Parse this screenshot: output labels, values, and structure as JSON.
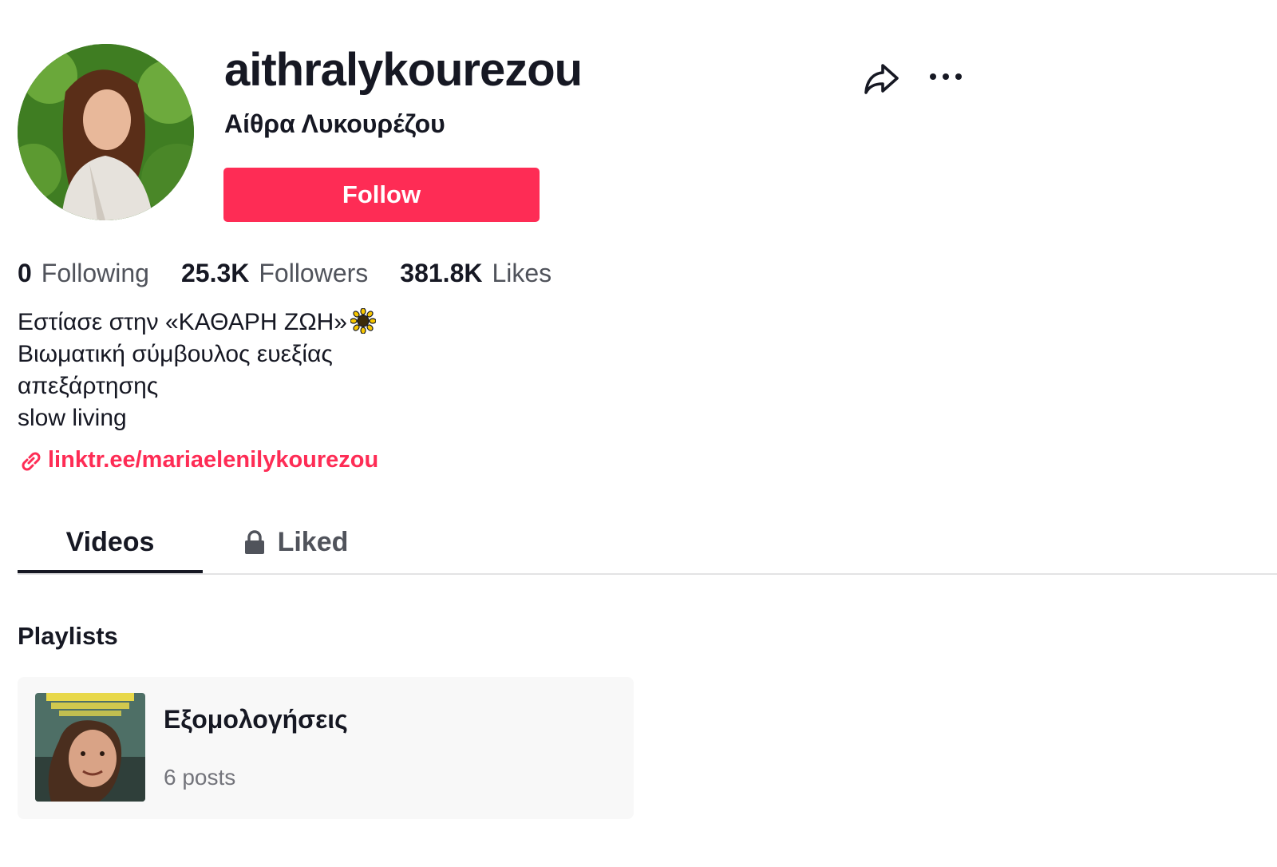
{
  "profile": {
    "username": "aithralykourezou",
    "nickname": "Αίθρα Λυκουρέζου",
    "follow_label": "Follow"
  },
  "stats": [
    {
      "count": "0",
      "label": "Following"
    },
    {
      "count": "25.3K",
      "label": "Followers"
    },
    {
      "count": "381.8K",
      "label": "Likes"
    }
  ],
  "bio": {
    "lines": [
      "Εστίασε στην «ΚΑΘΑΡΗ ΖΩΗ»",
      "Βιωματική σύμβουλος ευεξίας",
      "απεξάρτησης",
      "slow living"
    ],
    "emoji_icon": "sun-emoji",
    "link": "linktr.ee/mariaelenilykourezou"
  },
  "tabs": [
    {
      "label": "Videos",
      "active": true
    },
    {
      "label": "Liked",
      "locked": true
    }
  ],
  "playlists": {
    "section_title": "Playlists",
    "items": [
      {
        "name": "Εξομολογήσεις",
        "count": "6 posts"
      }
    ]
  },
  "colors": {
    "accent": "#fe2c55",
    "text_primary": "#161823",
    "text_secondary": "#50535b"
  }
}
